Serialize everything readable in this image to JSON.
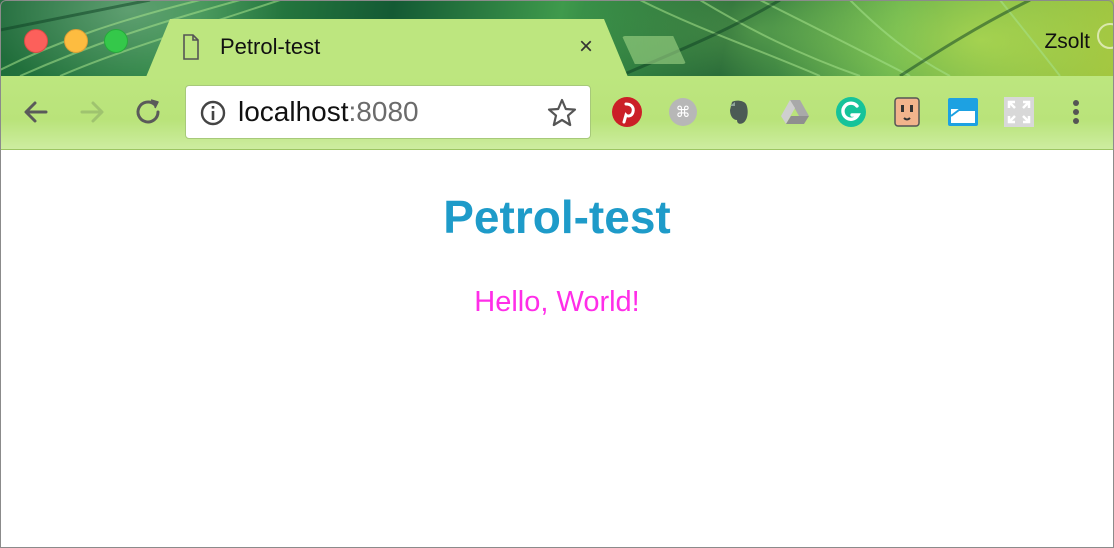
{
  "window": {
    "profile_name": "Zsolt"
  },
  "tab": {
    "title": "Petrol-test",
    "close_glyph": "×"
  },
  "toolbar": {
    "url_host": "localhost",
    "url_port": ":8080",
    "extensions": [
      "pinterest-icon",
      "command-icon",
      "evernote-icon",
      "google-drive-icon",
      "grammarly-icon",
      "outlet-icon",
      "window-extension-icon",
      "fullscreen-icon"
    ]
  },
  "page": {
    "heading": "Petrol-test",
    "greeting": "Hello, World!"
  },
  "colors": {
    "heading": "#1e9bc9",
    "greeting": "#ff2ee8",
    "toolbar": "#bde67f"
  }
}
